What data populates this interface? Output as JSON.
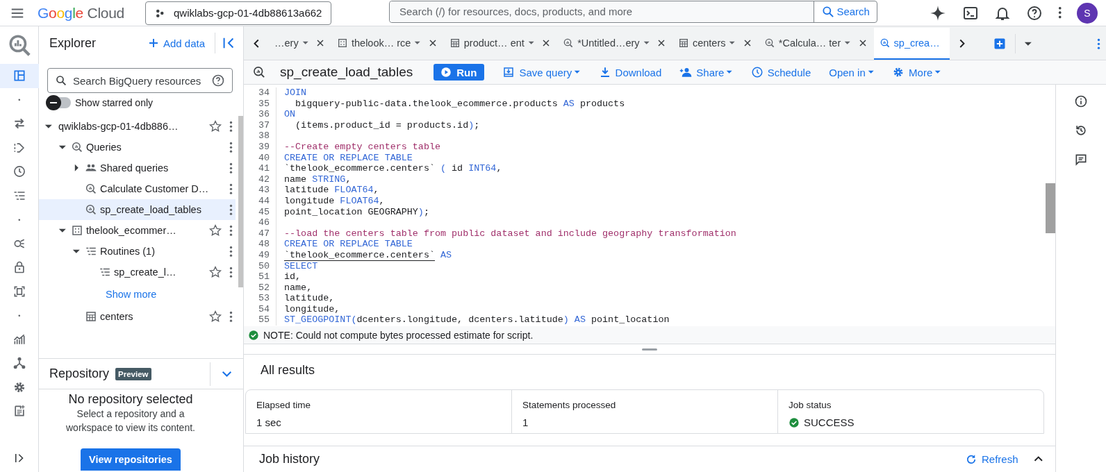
{
  "topbar": {
    "brand": "Google Cloud",
    "project": "qwiklabs-gcp-01-4db88613a662",
    "search": {
      "placeholder": "Search (/) for resources, docs, products, and more"
    },
    "search_button": "Search",
    "avatar": "S"
  },
  "rail": [
    {
      "kind": "explorer",
      "selected": true
    },
    {
      "kind": "dot",
      "selected": false
    },
    {
      "kind": "transfer",
      "selected": false
    },
    {
      "kind": "pipeline",
      "selected": false
    },
    {
      "kind": "clock",
      "selected": false
    },
    {
      "kind": "lines",
      "selected": false
    },
    {
      "kind": "dot",
      "selected": false
    },
    {
      "kind": "scan",
      "selected": false
    },
    {
      "kind": "lock",
      "selected": false
    },
    {
      "kind": "frame",
      "selected": false
    },
    {
      "kind": "dot",
      "selected": false
    },
    {
      "kind": "chart",
      "selected": false
    },
    {
      "kind": "graph",
      "selected": false
    },
    {
      "kind": "gear",
      "selected": false
    },
    {
      "kind": "notes",
      "selected": false
    }
  ],
  "explorer": {
    "title": "Explorer",
    "add_data": "Add data",
    "search": {
      "placeholder": "Search BigQuery resources"
    },
    "starred_toggle": {
      "label": "Show starred only",
      "on": false
    },
    "tree": [
      {
        "label": "qwiklabs-gcp-01-4db886…",
        "expanded": true,
        "star": true,
        "selected": false,
        "children": [
          {
            "kind": "queries",
            "label": "Queries",
            "expanded": true,
            "star": false,
            "selected": false,
            "children": [
              {
                "kind": "shared",
                "label": "Shared queries",
                "expanded": false,
                "star": false,
                "selected": false
              },
              {
                "kind": "query",
                "label": "Calculate Customer D…",
                "star": false,
                "selected": false
              },
              {
                "kind": "query",
                "label": "sp_create_load_tables",
                "star": false,
                "selected": true
              }
            ]
          },
          {
            "kind": "dataset",
            "label": "thelook_ecommer…",
            "expanded": true,
            "star": true,
            "selected": false,
            "children": [
              {
                "kind": "routines",
                "label": "Routines (1)",
                "expanded": true,
                "star": false,
                "selected": false,
                "children": [
                  {
                    "kind": "routine",
                    "label": "sp_create_l…",
                    "star": true,
                    "selected": false
                  }
                ]
              },
              {
                "kind": "link",
                "label": "Show more"
              },
              {
                "kind": "table",
                "label": "centers",
                "star": true,
                "selected": false
              }
            ]
          }
        ]
      }
    ]
  },
  "repository": {
    "title": "Repository",
    "badge": "Preview",
    "heading": "No repository selected",
    "text": "Select a repository and a workspace to view its content.",
    "button": "View repositories"
  },
  "tabs": [
    {
      "label": "…ery",
      "selected": false
    },
    {
      "kind": "dataset",
      "label": "thelook… rce",
      "selected": false
    },
    {
      "kind": "table",
      "label": "product… ent",
      "selected": false
    },
    {
      "kind": "query",
      "label": "*Untitled…ery",
      "selected": false
    },
    {
      "kind": "table",
      "label": "centers",
      "selected": false
    },
    {
      "kind": "query",
      "label": "*Calcula… ter",
      "selected": false
    },
    {
      "kind": "query",
      "label": "sp_crea…",
      "selected": true
    }
  ],
  "toolbar": {
    "title": "sp_create_load_tables",
    "run": "Run",
    "actions": [
      {
        "kind": "save",
        "label": "Save query",
        "menu": true
      },
      {
        "kind": "download",
        "label": "Download",
        "menu": false
      },
      {
        "kind": "share",
        "label": "Share",
        "menu": true
      },
      {
        "kind": "schedule",
        "label": "Schedule",
        "menu": false
      },
      {
        "kind": "open",
        "label": "Open in",
        "menu": true
      },
      {
        "kind": "more",
        "label": "More",
        "menu": true
      }
    ]
  },
  "code": [
    {
      "n": "34",
      "t": [
        {
          "kind": "kw",
          "text": "JOIN"
        }
      ]
    },
    {
      "n": "35",
      "t": [
        {
          "kind": "tx",
          "text": "  bigquery-public-data.thelook_ecommerce.products "
        },
        {
          "kind": "kw",
          "text": "AS"
        },
        {
          "kind": "tx",
          "text": " products"
        }
      ]
    },
    {
      "n": "36",
      "t": [
        {
          "kind": "kw",
          "text": "ON"
        }
      ]
    },
    {
      "n": "37",
      "t": [
        {
          "kind": "tx",
          "text": "  (items.product_id = products.id"
        },
        {
          "kind": "kw",
          "text": ")"
        },
        {
          "kind": "tx",
          "text": ";"
        }
      ]
    },
    {
      "n": "38"
    },
    {
      "n": "39",
      "t": [
        {
          "kind": "cm",
          "text": "--Create empty centers table"
        }
      ]
    },
    {
      "n": "40",
      "t": [
        {
          "kind": "kw",
          "text": "CREATE OR REPLACE TABLE"
        }
      ]
    },
    {
      "n": "41",
      "t": [
        {
          "kind": "tx",
          "text": "`thelook_ecommerce.centers` "
        },
        {
          "kind": "kw",
          "text": "("
        },
        {
          "kind": "tx",
          "text": " id "
        },
        {
          "kind": "kw",
          "text": "INT64"
        },
        {
          "kind": "tx",
          "text": ","
        }
      ]
    },
    {
      "n": "42",
      "t": [
        {
          "kind": "tx",
          "text": "name "
        },
        {
          "kind": "kw",
          "text": "STRING"
        },
        {
          "kind": "tx",
          "text": ","
        }
      ]
    },
    {
      "n": "43",
      "t": [
        {
          "kind": "tx",
          "text": "latitude "
        },
        {
          "kind": "kw",
          "text": "FLOAT64"
        },
        {
          "kind": "tx",
          "text": ","
        }
      ]
    },
    {
      "n": "44",
      "t": [
        {
          "kind": "tx",
          "text": "longitude "
        },
        {
          "kind": "kw",
          "text": "FLOAT64"
        },
        {
          "kind": "tx",
          "text": ","
        }
      ]
    },
    {
      "n": "45",
      "t": [
        {
          "kind": "tx",
          "text": "point_location GEOGRAPHY"
        },
        {
          "kind": "kw",
          "text": ")"
        },
        {
          "kind": "tx",
          "text": ";"
        }
      ]
    },
    {
      "n": "46"
    },
    {
      "n": "47",
      "t": [
        {
          "kind": "cm",
          "text": "--load the centers table from public dataset and include geography transformation"
        }
      ]
    },
    {
      "n": "48",
      "t": [
        {
          "kind": "kw",
          "text": "CREATE OR REPLACE TABLE"
        }
      ]
    },
    {
      "n": "49",
      "t": [
        {
          "kind": "ref",
          "text": "`thelook_ecommerce.centers`"
        },
        {
          "kind": "kw",
          "text": " AS"
        }
      ]
    },
    {
      "n": "50",
      "t": [
        {
          "kind": "kw",
          "text": "SELECT"
        }
      ]
    },
    {
      "n": "51",
      "t": [
        {
          "kind": "tx",
          "text": "id,"
        }
      ]
    },
    {
      "n": "52",
      "t": [
        {
          "kind": "tx",
          "text": "name,"
        }
      ]
    },
    {
      "n": "53",
      "t": [
        {
          "kind": "tx",
          "text": "latitude,"
        }
      ]
    },
    {
      "n": "54",
      "t": [
        {
          "kind": "tx",
          "text": "longitude,"
        }
      ]
    },
    {
      "n": "55",
      "t": [
        {
          "kind": "kw",
          "text": "ST_GEOGPOINT("
        },
        {
          "kind": "tx",
          "text": "dcenters.longitude, dcenters.latitude"
        },
        {
          "kind": "kw",
          "text": ") AS"
        },
        {
          "kind": "tx",
          "text": " point_location"
        }
      ]
    }
  ],
  "note": "NOTE: Could not compute bytes processed estimate for script.",
  "results": {
    "title": "All results",
    "stats": [
      {
        "kind": "plain",
        "label": "Elapsed time",
        "value": "1 sec"
      },
      {
        "kind": "plain",
        "label": "Statements processed",
        "value": "1"
      },
      {
        "kind": "status",
        "label": "Job status",
        "value": "SUCCESS"
      }
    ]
  },
  "job_history": {
    "title": "Job history",
    "refresh": "Refresh"
  }
}
